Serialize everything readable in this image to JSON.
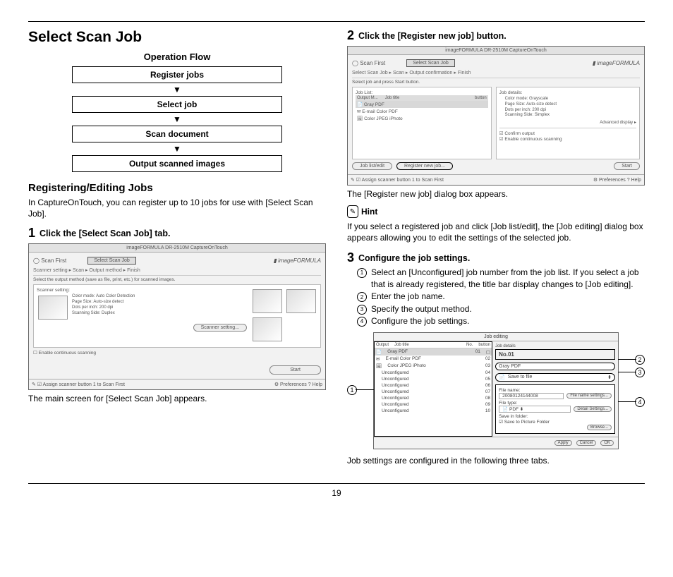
{
  "page_number": "19",
  "title": "Select Scan Job",
  "flow": {
    "heading": "Operation Flow",
    "steps": [
      "Register jobs",
      "Select job",
      "Scan document",
      "Output scanned images"
    ]
  },
  "section_registering": {
    "heading": "Registering/Editing Jobs",
    "intro": "In CaptureOnTouch, you can register up to 10 jobs for use with [Select Scan Job]."
  },
  "step1": {
    "num": "1",
    "text": "Click the [Select Scan Job] tab.",
    "caption": "The main screen for [Select Scan Job] appears.",
    "fig": {
      "titlebar": "imageFORMULA DR-2510M CaptureOnTouch",
      "tab_left": "Scan First",
      "tab_right": "Select Scan Job",
      "brand": "imageFORMULA",
      "flow_steps": "Scanner setting    ▸    Scan    ▸    Output method    ▸    Finish",
      "instruction": "Select the output method (save as file, print, etc.) for scanned images.",
      "settings_title": "Scanner setting:",
      "settings": [
        "Color mode:    Auto Color Detection",
        "Page Size:    Auto-size detect",
        "Dots per inch:    200 dpi",
        "Scanning Side:    Duplex"
      ],
      "scanner_setting_btn": "Scanner setting...",
      "checkbox": "Enable continuous scanning",
      "start": "Start",
      "footer_left": "Assign scanner button 1 to Scan First",
      "footer_prefs": "Preferences",
      "footer_help": "Help"
    }
  },
  "step2": {
    "num": "2",
    "text": "Click the [Register new job] button.",
    "caption": "The [Register new job] dialog box appears.",
    "fig": {
      "titlebar": "imageFORMULA DR-2510M CaptureOnTouch",
      "tab_left": "Scan First",
      "tab_right": "Select Scan Job",
      "brand": "imageFORMULA",
      "flow_steps": "Select Scan Job    ▸    Scan    ▸    Output confirmation    ▸    Finish",
      "instruction": "Select job and press Start button.",
      "joblist_head": "Job List:",
      "col_output": "Output M...",
      "col_title": "Job title",
      "col_button": "button",
      "jobs": [
        "Gray PDF",
        "E-mail Color PDF",
        "Color JPEG iPhoto"
      ],
      "details_head": "Job details:",
      "details": [
        "Color mode:    Grayscale",
        "Page Size:    Auto-size detect",
        "Dots per inch:    200 dpi",
        "Scanning Side:    Simplex"
      ],
      "advanced": "Advanced display ▸",
      "confirm_cb": "Confirm output",
      "enable_cb": "Enable continuous scanning",
      "joblist_edit": "Job list/edit",
      "register_btn": "Register new job...",
      "start": "Start",
      "footer_left": "Assign scanner button 1 to Scan First",
      "footer_prefs": "Preferences",
      "footer_help": "Help"
    }
  },
  "hint": {
    "label": "Hint",
    "text": "If you select a registered job and click [Job list/edit], the [Job editing] dialog box appears allowing you to edit the settings of the selected job."
  },
  "step3": {
    "num": "3",
    "text": "Configure the job settings.",
    "items": [
      "Select an [Unconfigured] job number from the job list. If you select a job that is already registered, the title bar display changes to [Job editing].",
      "Enter the job name.",
      "Specify the output method.",
      "Configure the job settings."
    ],
    "caption": "Job settings are configured in the following three tabs.",
    "fig": {
      "titlebar": "Job editing",
      "col_output": "Output",
      "col_title": "Job title",
      "col_no": "No.",
      "col_button": "button",
      "details_head": "Job details",
      "no_label": "No.01",
      "jobs": [
        {
          "title": "Gray PDF",
          "no": "01"
        },
        {
          "title": "E-mail Color PDF",
          "no": "02"
        },
        {
          "title": "Color JPEG iPhoto",
          "no": "03"
        },
        {
          "title": "Unconfigured",
          "no": "04"
        },
        {
          "title": "Unconfigured",
          "no": "05"
        },
        {
          "title": "Unconfigured",
          "no": "06"
        },
        {
          "title": "Unconfigured",
          "no": "07"
        },
        {
          "title": "Unconfigured",
          "no": "08"
        },
        {
          "title": "Unconfigured",
          "no": "09"
        },
        {
          "title": "Unconfigured",
          "no": "10"
        }
      ],
      "jobname_field": "Gray PDF",
      "output_field": "Save to file",
      "filename_label": "File name:",
      "filename_value": "20080124144008",
      "filename_btn": "File name settings...",
      "filetype_label": "File type:",
      "filetype_value": "PDF",
      "filetype_btn": "Detail Settings...",
      "savein_label": "Save in folder:",
      "savein_cb": "Save to Picture Folder",
      "browse": "Browse...",
      "apply": "Apply",
      "cancel": "Cancel",
      "ok": "OK"
    }
  }
}
